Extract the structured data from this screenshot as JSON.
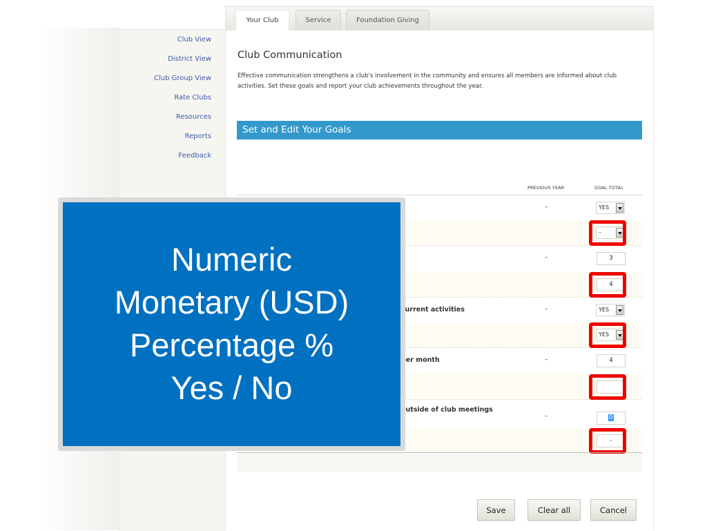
{
  "tabs": [
    {
      "label": "Your Club",
      "active": true
    },
    {
      "label": "Service",
      "active": false
    },
    {
      "label": "Foundation Giving",
      "active": false
    }
  ],
  "sidebar": {
    "items": [
      {
        "label": "Club View"
      },
      {
        "label": "District View"
      },
      {
        "label": "Club Group View"
      },
      {
        "label": "Rate Clubs"
      },
      {
        "label": "Resources"
      },
      {
        "label": "Reports"
      },
      {
        "label": "Feedback"
      }
    ]
  },
  "page": {
    "title": "Club Communication",
    "description": "Effective communication strengthens a club's involvement in the community and ensures all members are informed about club activities. Set these goals and report your club achievements throughout the year."
  },
  "section": {
    "title": "Set and Edit Your Goals",
    "columns": {
      "previous_year": "PREVIOUS YEAR",
      "goal_total": "GOAL TOTAL"
    }
  },
  "goals": [
    {
      "label": "",
      "previous": "–",
      "type": "select",
      "value": "YES",
      "highlighted": false,
      "alt": false
    },
    {
      "label": "",
      "previous": "",
      "type": "select",
      "value": "–",
      "highlighted": true,
      "alt": true
    },
    {
      "label": "",
      "previous": "–",
      "type": "text",
      "value": "3",
      "highlighted": false,
      "alt": false
    },
    {
      "label": "",
      "previous": "",
      "type": "text",
      "value": "4",
      "highlighted": true,
      "alt": true
    },
    {
      "label": "current activities",
      "previous": "–",
      "type": "select",
      "value": "YES",
      "highlighted": false,
      "alt": false
    },
    {
      "label": "",
      "previous": "",
      "type": "select",
      "value": "YES",
      "highlighted": true,
      "alt": true
    },
    {
      "label": "per month",
      "previous": "–",
      "type": "text",
      "value": "4",
      "highlighted": false,
      "alt": false
    },
    {
      "label": "",
      "previous": "",
      "type": "text",
      "value": "",
      "highlighted": true,
      "alt": true
    },
    {
      "label": "outside of club meetings",
      "previous": "–",
      "type": "text",
      "value": "0",
      "selected_text": true,
      "highlighted": false,
      "alt": false
    },
    {
      "label": "",
      "previous": "",
      "type": "text",
      "value": "-",
      "highlighted": true,
      "alt": true
    }
  ],
  "buttons": {
    "save": "Save",
    "clear_all": "Clear all",
    "cancel": "Cancel"
  },
  "callout": {
    "lines": [
      "Numeric",
      "Monetary (USD)",
      "Percentage %",
      "Yes / No"
    ],
    "background_color": "#0070c0",
    "highlight_color": "#ee0000"
  }
}
